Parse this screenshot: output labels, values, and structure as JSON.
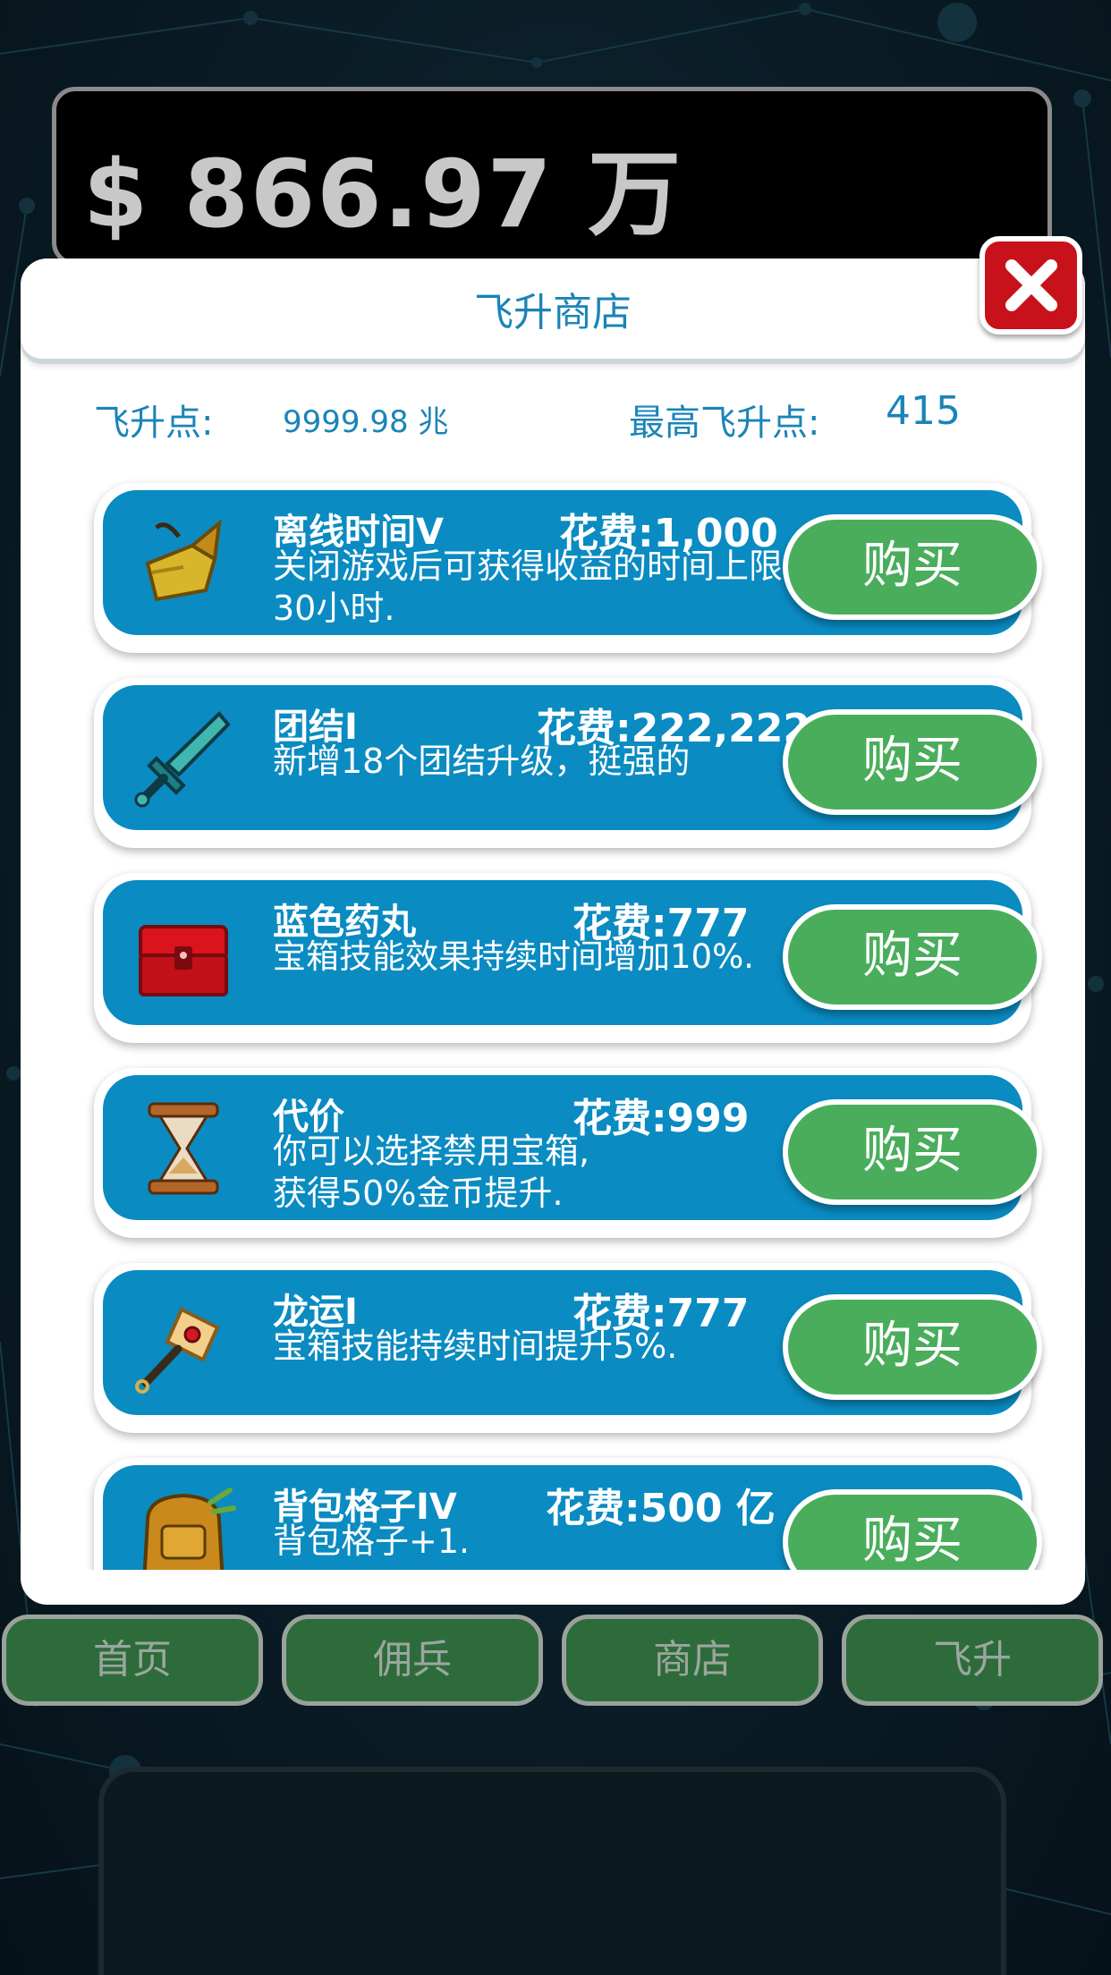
{
  "wallet": {
    "amount": "$ 866.97 万"
  },
  "shop": {
    "title": "飞升商店",
    "points_label": "飞升点:",
    "points_value": "9999.98 兆",
    "max_points_label": "最高飞升点:",
    "max_points_value": "415"
  },
  "items": [
    {
      "icon": "golden-gauntlet-icon",
      "name": "离线时间V",
      "cost": "花费:1,000",
      "desc": "关闭游戏后可获得收益的时间上限30小时.",
      "buy_label": "购买"
    },
    {
      "icon": "teal-sword-icon",
      "name": "团结I",
      "cost": "花费:222,222",
      "desc": "新增18个团结升级，挺强的",
      "buy_label": "购买"
    },
    {
      "icon": "red-chest-icon",
      "name": "蓝色药丸",
      "cost": "花费:777",
      "desc": "宝箱技能效果持续时间增加10%.",
      "buy_label": "购买"
    },
    {
      "icon": "hourglass-icon",
      "name": "代价",
      "cost": "花费:999",
      "desc": "你可以选择禁用宝箱,\n获得50%金币提升.",
      "buy_label": "购买"
    },
    {
      "icon": "hammer-icon",
      "name": "龙运I",
      "cost": "花费:777",
      "desc": "宝箱技能持续时间提升5%.",
      "buy_label": "购买"
    },
    {
      "icon": "backpack-icon",
      "name": "背包格子IV",
      "cost": "花费:500 亿",
      "desc": "背包格子+1.",
      "buy_label": "购买"
    }
  ],
  "nav": [
    {
      "label": "首页"
    },
    {
      "label": "佣兵"
    },
    {
      "label": "商店"
    },
    {
      "label": "飞升"
    }
  ]
}
